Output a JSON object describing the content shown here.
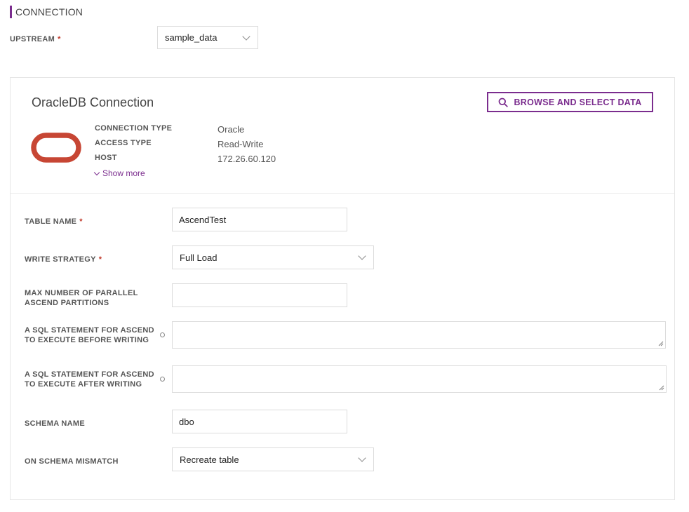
{
  "section": {
    "title": "CONNECTION"
  },
  "upstream": {
    "label": "UPSTREAM",
    "required_mark": "*",
    "value": "sample_data"
  },
  "connection_card": {
    "title": "OracleDB Connection",
    "browse_label": "BROWSE AND SELECT DATA",
    "meta": [
      {
        "label": "CONNECTION TYPE",
        "value": "Oracle"
      },
      {
        "label": "ACCESS TYPE",
        "value": "Read-Write"
      },
      {
        "label": "HOST",
        "value": "172.26.60.120"
      }
    ],
    "show_more": "Show more",
    "logo_icon": "oracle-logo",
    "accent_color": "#7b2d8e",
    "logo_color": "#c74634"
  },
  "form": {
    "table_name": {
      "label": "TABLE NAME",
      "required_mark": "*",
      "value": "AscendTest"
    },
    "write_strategy": {
      "label": "WRITE STRATEGY",
      "required_mark": "*",
      "value": "Full Load"
    },
    "max_partitions": {
      "label_line1": "MAX NUMBER OF PARALLEL",
      "label_line2": "ASCEND PARTITIONS",
      "value": ""
    },
    "sql_before": {
      "label_line1": "A SQL STATEMENT FOR ASCEND",
      "label_line2": "TO EXECUTE BEFORE WRITING",
      "value": ""
    },
    "sql_after": {
      "label_line1": "A SQL STATEMENT FOR ASCEND",
      "label_line2": "TO EXECUTE AFTER WRITING",
      "value": ""
    },
    "schema_name": {
      "label": "SCHEMA NAME",
      "value": "dbo"
    },
    "schema_mismatch": {
      "label": "ON SCHEMA MISMATCH",
      "value": "Recreate table"
    }
  }
}
